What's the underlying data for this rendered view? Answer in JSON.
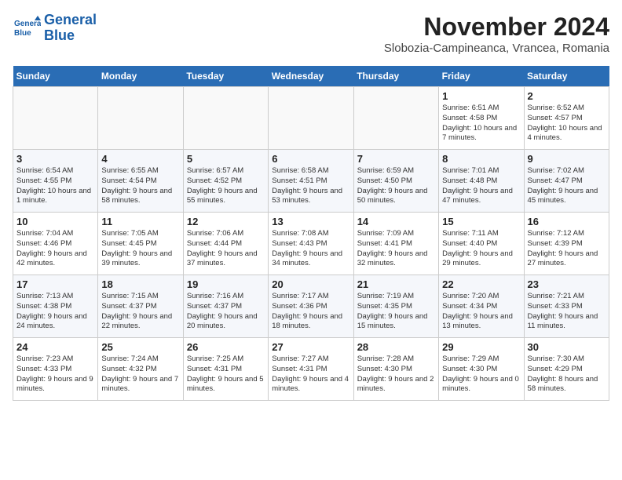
{
  "logo": {
    "line1": "General",
    "line2": "Blue"
  },
  "header": {
    "month_year": "November 2024",
    "location": "Slobozia-Campineanca, Vrancea, Romania"
  },
  "weekdays": [
    "Sunday",
    "Monday",
    "Tuesday",
    "Wednesday",
    "Thursday",
    "Friday",
    "Saturday"
  ],
  "weeks": [
    [
      {
        "day": "",
        "info": ""
      },
      {
        "day": "",
        "info": ""
      },
      {
        "day": "",
        "info": ""
      },
      {
        "day": "",
        "info": ""
      },
      {
        "day": "",
        "info": ""
      },
      {
        "day": "1",
        "info": "Sunrise: 6:51 AM\nSunset: 4:58 PM\nDaylight: 10 hours\nand 7 minutes."
      },
      {
        "day": "2",
        "info": "Sunrise: 6:52 AM\nSunset: 4:57 PM\nDaylight: 10 hours\nand 4 minutes."
      }
    ],
    [
      {
        "day": "3",
        "info": "Sunrise: 6:54 AM\nSunset: 4:55 PM\nDaylight: 10 hours\nand 1 minute."
      },
      {
        "day": "4",
        "info": "Sunrise: 6:55 AM\nSunset: 4:54 PM\nDaylight: 9 hours\nand 58 minutes."
      },
      {
        "day": "5",
        "info": "Sunrise: 6:57 AM\nSunset: 4:52 PM\nDaylight: 9 hours\nand 55 minutes."
      },
      {
        "day": "6",
        "info": "Sunrise: 6:58 AM\nSunset: 4:51 PM\nDaylight: 9 hours\nand 53 minutes."
      },
      {
        "day": "7",
        "info": "Sunrise: 6:59 AM\nSunset: 4:50 PM\nDaylight: 9 hours\nand 50 minutes."
      },
      {
        "day": "8",
        "info": "Sunrise: 7:01 AM\nSunset: 4:48 PM\nDaylight: 9 hours\nand 47 minutes."
      },
      {
        "day": "9",
        "info": "Sunrise: 7:02 AM\nSunset: 4:47 PM\nDaylight: 9 hours\nand 45 minutes."
      }
    ],
    [
      {
        "day": "10",
        "info": "Sunrise: 7:04 AM\nSunset: 4:46 PM\nDaylight: 9 hours\nand 42 minutes."
      },
      {
        "day": "11",
        "info": "Sunrise: 7:05 AM\nSunset: 4:45 PM\nDaylight: 9 hours\nand 39 minutes."
      },
      {
        "day": "12",
        "info": "Sunrise: 7:06 AM\nSunset: 4:44 PM\nDaylight: 9 hours\nand 37 minutes."
      },
      {
        "day": "13",
        "info": "Sunrise: 7:08 AM\nSunset: 4:43 PM\nDaylight: 9 hours\nand 34 minutes."
      },
      {
        "day": "14",
        "info": "Sunrise: 7:09 AM\nSunset: 4:41 PM\nDaylight: 9 hours\nand 32 minutes."
      },
      {
        "day": "15",
        "info": "Sunrise: 7:11 AM\nSunset: 4:40 PM\nDaylight: 9 hours\nand 29 minutes."
      },
      {
        "day": "16",
        "info": "Sunrise: 7:12 AM\nSunset: 4:39 PM\nDaylight: 9 hours\nand 27 minutes."
      }
    ],
    [
      {
        "day": "17",
        "info": "Sunrise: 7:13 AM\nSunset: 4:38 PM\nDaylight: 9 hours\nand 24 minutes."
      },
      {
        "day": "18",
        "info": "Sunrise: 7:15 AM\nSunset: 4:37 PM\nDaylight: 9 hours\nand 22 minutes."
      },
      {
        "day": "19",
        "info": "Sunrise: 7:16 AM\nSunset: 4:37 PM\nDaylight: 9 hours\nand 20 minutes."
      },
      {
        "day": "20",
        "info": "Sunrise: 7:17 AM\nSunset: 4:36 PM\nDaylight: 9 hours\nand 18 minutes."
      },
      {
        "day": "21",
        "info": "Sunrise: 7:19 AM\nSunset: 4:35 PM\nDaylight: 9 hours\nand 15 minutes."
      },
      {
        "day": "22",
        "info": "Sunrise: 7:20 AM\nSunset: 4:34 PM\nDaylight: 9 hours\nand 13 minutes."
      },
      {
        "day": "23",
        "info": "Sunrise: 7:21 AM\nSunset: 4:33 PM\nDaylight: 9 hours\nand 11 minutes."
      }
    ],
    [
      {
        "day": "24",
        "info": "Sunrise: 7:23 AM\nSunset: 4:33 PM\nDaylight: 9 hours\nand 9 minutes."
      },
      {
        "day": "25",
        "info": "Sunrise: 7:24 AM\nSunset: 4:32 PM\nDaylight: 9 hours\nand 7 minutes."
      },
      {
        "day": "26",
        "info": "Sunrise: 7:25 AM\nSunset: 4:31 PM\nDaylight: 9 hours\nand 5 minutes."
      },
      {
        "day": "27",
        "info": "Sunrise: 7:27 AM\nSunset: 4:31 PM\nDaylight: 9 hours\nand 4 minutes."
      },
      {
        "day": "28",
        "info": "Sunrise: 7:28 AM\nSunset: 4:30 PM\nDaylight: 9 hours\nand 2 minutes."
      },
      {
        "day": "29",
        "info": "Sunrise: 7:29 AM\nSunset: 4:30 PM\nDaylight: 9 hours\nand 0 minutes."
      },
      {
        "day": "30",
        "info": "Sunrise: 7:30 AM\nSunset: 4:29 PM\nDaylight: 8 hours\nand 58 minutes."
      }
    ]
  ]
}
